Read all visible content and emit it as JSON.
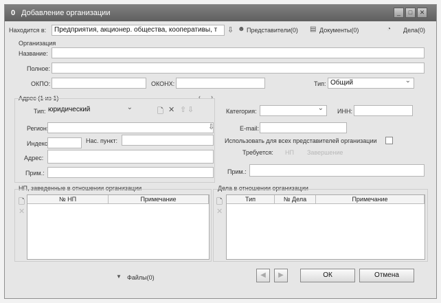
{
  "window": {
    "title": "Добавление организации",
    "title_icon": "0",
    "controls": [
      "minimize-icon",
      "maximize-icon",
      "close-icon"
    ]
  },
  "toolbar": {
    "location_label": "Находится в:",
    "location_value": "Предприятия, акционер. общества, кооперативы, т",
    "representatives": "Представители(0)",
    "documents": "Документы(0)",
    "cases": "Дела(0)"
  },
  "organization": {
    "section_label": "Организация",
    "name_label": "Название:",
    "name_value": "",
    "full_label": "Полное:",
    "full_value": "",
    "okpo_label": "ОКПО:",
    "okpo_value": "",
    "okonh_label": "ОКОНХ:",
    "okonh_value": "",
    "type_label": "Тип:",
    "type_value": "Общий"
  },
  "address": {
    "section_label": "Адрес (1 из 1)",
    "type_label": "Тип:",
    "type_value": "юридический",
    "region_label": "Регион:",
    "region_value": "",
    "index_label": "Индекс:",
    "index_value": "",
    "locality_label": "Нас. пункт:",
    "locality_value": "",
    "address_label": "Адрес:",
    "address_value": "",
    "note_label": "Прим.:",
    "note_value": ""
  },
  "contact": {
    "category_label": "Категория:",
    "category_value": "",
    "inn_label": "ИНН:",
    "inn_value": "",
    "email_label": "E-mail:",
    "email_value": "",
    "use_for_all_label": "Использовать для всех представителей организации",
    "use_for_all_checked": false,
    "required_label": "Требуется:",
    "required_opt1": "НП",
    "required_opt2": "Завершение",
    "note_label": "Прим.:",
    "note_value": ""
  },
  "np_panel": {
    "title": "НП, заведенные в отношении организации",
    "columns": [
      "№ НП",
      "Примечание"
    ],
    "rows": []
  },
  "cases_panel": {
    "title": "Дела в отношении организации",
    "columns": [
      "Тип",
      "№ Дела",
      "Примечание"
    ],
    "rows": []
  },
  "footer": {
    "files": "Файлы(0)",
    "ok": "ОК",
    "cancel": "Отмена"
  }
}
